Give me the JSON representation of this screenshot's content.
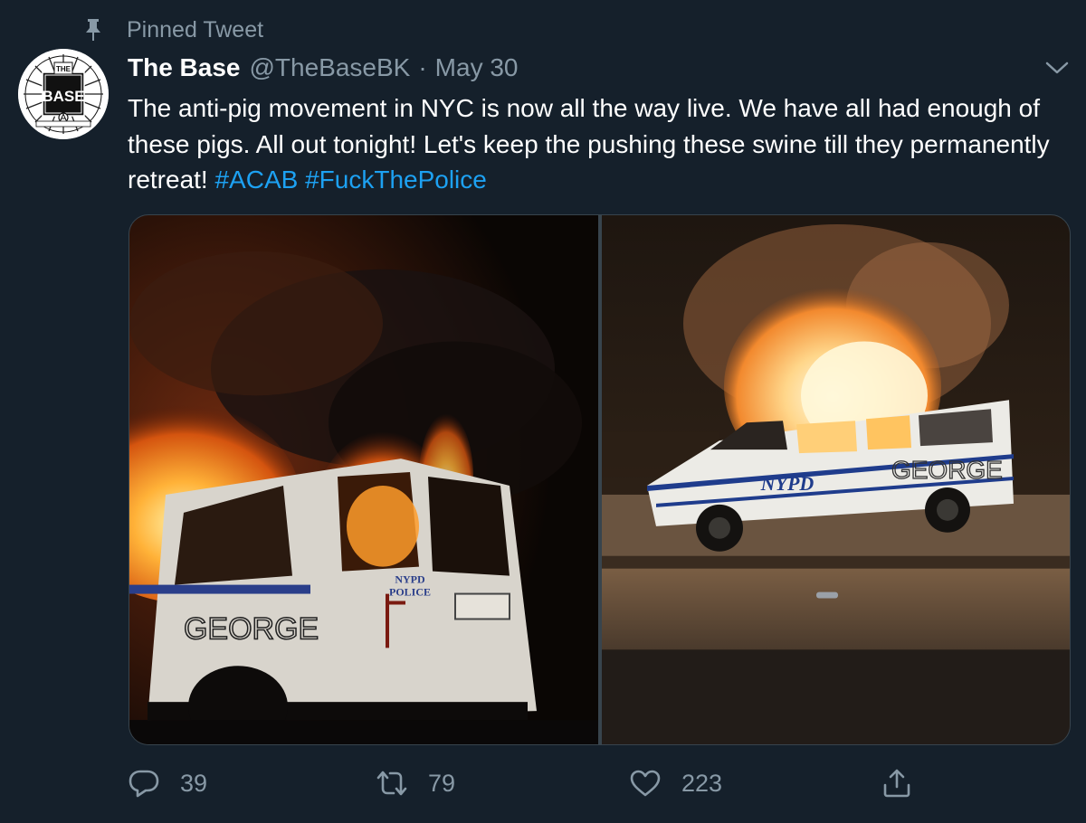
{
  "pinned": {
    "label": "Pinned Tweet",
    "icon": "pin-icon"
  },
  "author": {
    "display_name": "The Base",
    "handle": "@TheBaseBK",
    "separator": "·",
    "date": "May 30",
    "avatar": {
      "icon": "the-base-logo",
      "logo_text_top": "THE",
      "logo_text_main": "BASE"
    }
  },
  "tweet": {
    "text": "The anti-pig movement in NYC is now all the way live. We have all had enough of these pigs. All out tonight! Let's keep the pushing these swine till they permanently retreat!",
    "hashtags": [
      "#ACAB",
      "#FuckThePolice"
    ]
  },
  "media": [
    {
      "icon": "burning-police-van-photo",
      "painted_text": [
        "NYPD",
        "POLICE",
        "GEORGE"
      ]
    },
    {
      "icon": "burning-nypd-van-photo",
      "painted_text": [
        "NYPD",
        "GEORGE"
      ]
    }
  ],
  "actions": {
    "reply": {
      "icon": "reply-icon",
      "count": "39"
    },
    "retweet": {
      "icon": "retweet-icon",
      "count": "79"
    },
    "like": {
      "icon": "heart-icon",
      "count": "223"
    },
    "share": {
      "icon": "share-icon"
    }
  },
  "colors": {
    "background": "#15202b",
    "secondary_text": "#8899a6",
    "link": "#1da1f2",
    "border": "#38444d"
  }
}
